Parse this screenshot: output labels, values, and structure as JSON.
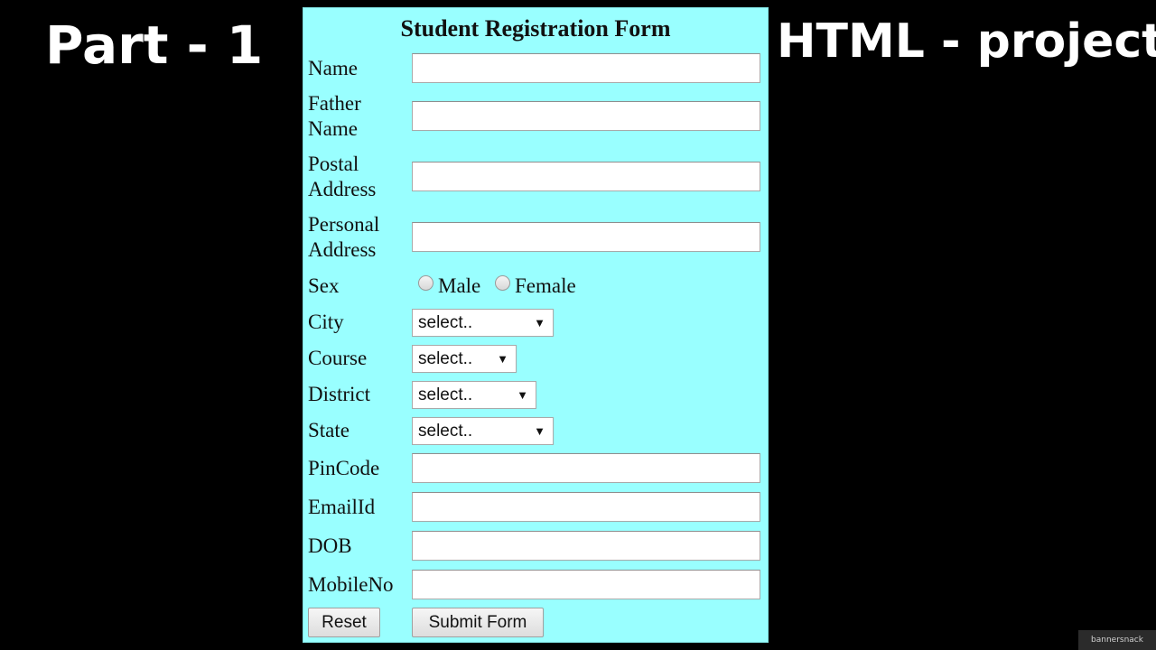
{
  "banner": {
    "left_text": "Part - 1",
    "right_text": "HTML - project"
  },
  "form": {
    "title": "Student Registration Form",
    "fields": {
      "name": {
        "label": "Name",
        "value": ""
      },
      "father_name": {
        "label": "Father Name",
        "value": ""
      },
      "postal_address": {
        "label": "Postal Address",
        "value": ""
      },
      "personal_address": {
        "label": "Personal Address",
        "value": ""
      },
      "sex": {
        "label": "Sex",
        "options": [
          "Male",
          "Female"
        ]
      },
      "city": {
        "label": "City",
        "selected": "select.."
      },
      "course": {
        "label": "Course",
        "selected": "select.."
      },
      "district": {
        "label": "District",
        "selected": "select.."
      },
      "state": {
        "label": "State",
        "selected": "select.."
      },
      "pincode": {
        "label": "PinCode",
        "value": ""
      },
      "email": {
        "label": "EmailId",
        "value": ""
      },
      "dob": {
        "label": "DOB",
        "value": ""
      },
      "mobile": {
        "label": "MobileNo",
        "value": ""
      }
    },
    "buttons": {
      "reset": "Reset",
      "submit": "Submit Form"
    },
    "icons": {
      "select_arrow": "▼"
    },
    "colors": {
      "panel_background": "#99ffff",
      "page_background": "#000000"
    }
  },
  "watermark": {
    "text": "bannersnack"
  }
}
